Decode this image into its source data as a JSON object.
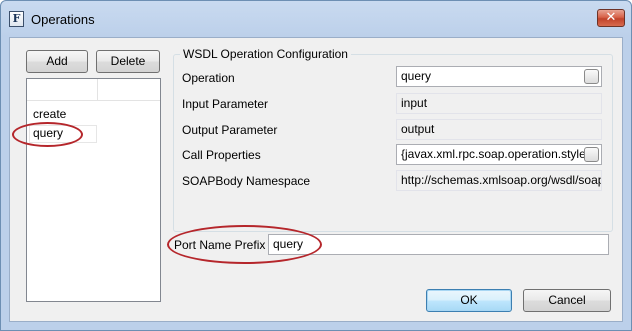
{
  "window": {
    "title": "Operations",
    "app_icon_letter": "F",
    "close_glyph": "✕"
  },
  "left_panel": {
    "add_label": "Add",
    "delete_label": "Delete",
    "items": [
      "create",
      "query"
    ]
  },
  "config": {
    "group_title": "WSDL Operation Configuration",
    "rows": [
      {
        "label": "Operation",
        "value": "query"
      },
      {
        "label": "Input Parameter",
        "value": "input"
      },
      {
        "label": "Output Parameter",
        "value": "output"
      },
      {
        "label": "Call Properties",
        "value": "{javax.xml.rpc.soap.operation.style="
      },
      {
        "label": "SOAPBody Namespace",
        "value": "http://schemas.xmlsoap.org/wsdl/soap"
      }
    ]
  },
  "port_prefix": {
    "label": "Port Name Prefix",
    "value": "query"
  },
  "footer": {
    "ok_label": "OK",
    "cancel_label": "Cancel"
  },
  "colors": {
    "highlight_oval": "#b5262b",
    "default_button_border": "#3c7fb1"
  }
}
